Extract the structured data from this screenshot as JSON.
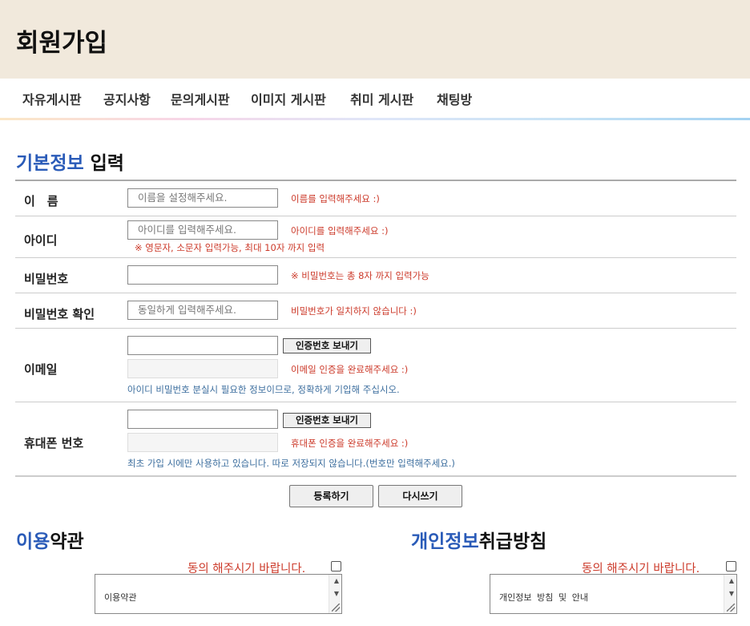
{
  "header": {
    "title": "회원가입"
  },
  "nav": {
    "items": [
      "자유게시판",
      "공지사항",
      "문의게시판",
      "이미지 게시판",
      "취미 게시판",
      "채팅방"
    ]
  },
  "basic_info": {
    "accent": "기본정보",
    "rest": " 입력"
  },
  "form": {
    "name": {
      "label": "이　름",
      "placeholder": "이름을 설정해주세요.",
      "message": "이름를 입력해주세요 :)"
    },
    "id": {
      "label": "아이디",
      "placeholder": "아이디를 입력해주세요.",
      "message": "아이디를 입력해주세요 :)",
      "note": "※ 영문자, 소문자 입력가능, 최대 10자 까지 입력"
    },
    "password": {
      "label": "비밀번호",
      "value": "",
      "message": "※ 비밀번호는 총 8자 까지 입력가능"
    },
    "password_confirm": {
      "label": "비밀번호 확인",
      "placeholder": "동일하게 입력해주세요.",
      "message": "비밀번호가 일치하지 않습니다 :)"
    },
    "email": {
      "label": "이메일",
      "value": "",
      "send_button": "인증번호 보내기",
      "code_value": "",
      "message": "이메일 인증을 완료해주세요 :)",
      "note": "아이디 비밀번호 분실시 필요한 정보이므로, 정확하게 기입해 주십시오."
    },
    "phone": {
      "label": "휴대폰 번호",
      "value": "",
      "send_button": "인증번호 보내기",
      "code_value": "",
      "message": "휴대폰 인증을 완료해주세요 :)",
      "note": "최초 가입 시에만 사용하고 있습니다. 따로 저장되지 않습니다.(번호만 입력해주세요.)"
    }
  },
  "buttons": {
    "submit": "등록하기",
    "reset": "다시쓰기"
  },
  "terms": {
    "accent": "이용",
    "rest": "약관",
    "agree": "동의 해주시기 바랍니다.",
    "content": "이용약관"
  },
  "privacy": {
    "accent": "개인정보",
    "rest": "취급방침",
    "agree": "동의 해주시기 바랍니다.",
    "content": "개인정보 방침 및 안내"
  },
  "colors": {
    "accent": "#2a5bb8",
    "error": "#cc3a2a",
    "note": "#3c6e9e",
    "header_bg": "#f1e9dc"
  }
}
